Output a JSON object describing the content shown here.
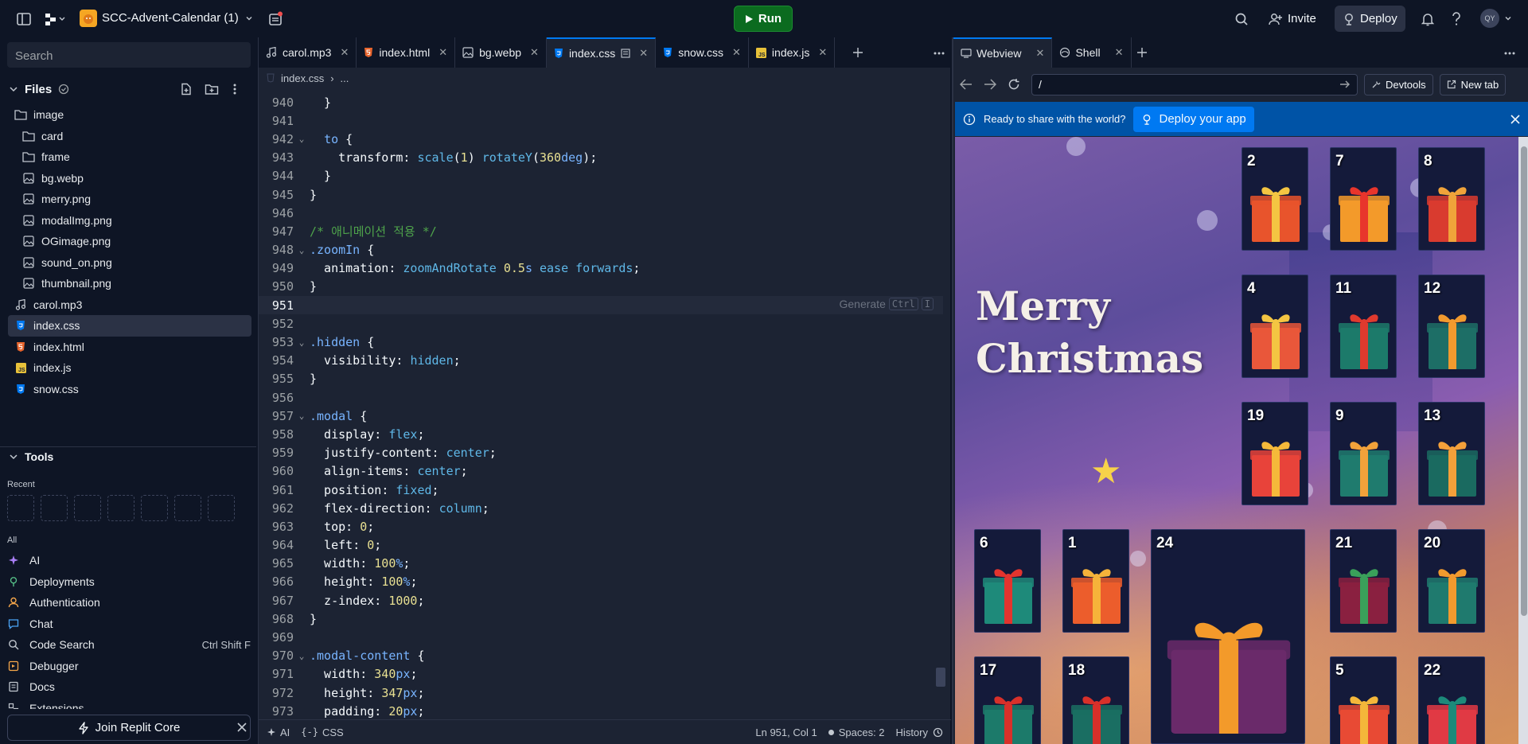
{
  "topbar": {
    "project_name": "SCC-Advent-Calendar (1)",
    "run_label": "Run",
    "invite_label": "Invite",
    "deploy_label": "Deploy",
    "avatar_initials": "QY"
  },
  "sidebar": {
    "search_placeholder": "Search",
    "files_label": "Files",
    "tree": [
      {
        "name": "image",
        "type": "folder",
        "depth": 0
      },
      {
        "name": "card",
        "type": "folder",
        "depth": 1
      },
      {
        "name": "frame",
        "type": "folder",
        "depth": 1
      },
      {
        "name": "bg.webp",
        "type": "image",
        "depth": 1
      },
      {
        "name": "merry.png",
        "type": "image",
        "depth": 1
      },
      {
        "name": "modalImg.png",
        "type": "image",
        "depth": 1
      },
      {
        "name": "OGimage.png",
        "type": "image",
        "depth": 1
      },
      {
        "name": "sound_on.png",
        "type": "image",
        "depth": 1
      },
      {
        "name": "thumbnail.png",
        "type": "image",
        "depth": 1
      },
      {
        "name": "carol.mp3",
        "type": "audio",
        "depth": 0
      },
      {
        "name": "index.css",
        "type": "css",
        "depth": 0,
        "selected": true
      },
      {
        "name": "index.html",
        "type": "html",
        "depth": 0
      },
      {
        "name": "index.js",
        "type": "js",
        "depth": 0
      },
      {
        "name": "snow.css",
        "type": "css",
        "depth": 0
      }
    ],
    "tools_label": "Tools",
    "recent_label": "Recent",
    "all_label": "All",
    "tools": [
      {
        "label": "AI",
        "icon": "ai-icon"
      },
      {
        "label": "Deployments",
        "icon": "deployments-icon"
      },
      {
        "label": "Authentication",
        "icon": "authentication-icon"
      },
      {
        "label": "Chat",
        "icon": "chat-icon"
      },
      {
        "label": "Code Search",
        "icon": "search-icon",
        "shortcut": "Ctrl Shift F"
      },
      {
        "label": "Debugger",
        "icon": "debugger-icon"
      },
      {
        "label": "Docs",
        "icon": "docs-icon"
      },
      {
        "label": "Extensions",
        "icon": "extensions-icon"
      }
    ],
    "join_label": "Join Replit Core"
  },
  "editor": {
    "tabs": [
      {
        "label": "carol.mp3",
        "icon": "audio-icon"
      },
      {
        "label": "index.html",
        "icon": "html-icon"
      },
      {
        "label": "bg.webp",
        "icon": "image-icon"
      },
      {
        "label": "index.css",
        "icon": "css-icon",
        "active": true
      },
      {
        "label": "snow.css",
        "icon": "css-icon"
      },
      {
        "label": "index.js",
        "icon": "js-icon"
      }
    ],
    "breadcrumb_file": "index.css",
    "breadcrumb_more": "...",
    "generate_hint": "Generate",
    "generate_key1": "Ctrl",
    "generate_key2": "I",
    "lines": [
      {
        "n": "940",
        "fold": false,
        "code": [
          [
            "  }",
            "#f5f9fc"
          ]
        ]
      },
      {
        "n": "941",
        "fold": false,
        "code": []
      },
      {
        "n": "942",
        "fold": true,
        "code": [
          [
            "  ",
            "#f5f9fc"
          ],
          [
            "to",
            "#78b4ff"
          ],
          [
            " {",
            "#f5f9fc"
          ]
        ]
      },
      {
        "n": "943",
        "fold": false,
        "code": [
          [
            "    ",
            "#f5f9fc"
          ],
          [
            "transform",
            "#f5f9fc"
          ],
          [
            ": ",
            "#f5f9fc"
          ],
          [
            "scale",
            "#5fb8e8"
          ],
          [
            "(",
            "#f5f9fc"
          ],
          [
            "1",
            "#e8e092"
          ],
          [
            ") ",
            "#f5f9fc"
          ],
          [
            "rotateY",
            "#5fb8e8"
          ],
          [
            "(",
            "#f5f9fc"
          ],
          [
            "360",
            "#e8e092"
          ],
          [
            "deg",
            "#78b4ff"
          ],
          [
            ");",
            "#f5f9fc"
          ]
        ]
      },
      {
        "n": "944",
        "fold": false,
        "code": [
          [
            "  }",
            "#f5f9fc"
          ]
        ]
      },
      {
        "n": "945",
        "fold": false,
        "code": [
          [
            "}",
            "#f5f9fc"
          ]
        ]
      },
      {
        "n": "946",
        "fold": false,
        "code": []
      },
      {
        "n": "947",
        "fold": false,
        "code": [
          [
            "/* 애니메이션 적용 */",
            "#4ea34b"
          ]
        ]
      },
      {
        "n": "948",
        "fold": true,
        "code": [
          [
            ".zoomIn",
            "#78b4ff"
          ],
          [
            " {",
            "#f5f9fc"
          ]
        ]
      },
      {
        "n": "949",
        "fold": false,
        "code": [
          [
            "  animation",
            "#f5f9fc"
          ],
          [
            ": ",
            "#f5f9fc"
          ],
          [
            "zoomAndRotate",
            "#5fb8e8"
          ],
          [
            " ",
            "#f5f9fc"
          ],
          [
            "0.5",
            "#e8e092"
          ],
          [
            "s",
            "#78b4ff"
          ],
          [
            " ",
            "#f5f9fc"
          ],
          [
            "ease forwards",
            "#5fb8e8"
          ],
          [
            ";",
            "#f5f9fc"
          ]
        ]
      },
      {
        "n": "950",
        "fold": false,
        "code": [
          [
            "}",
            "#f5f9fc"
          ]
        ]
      },
      {
        "n": "951",
        "fold": false,
        "current": true,
        "code": []
      },
      {
        "n": "952",
        "fold": false,
        "code": []
      },
      {
        "n": "953",
        "fold": true,
        "code": [
          [
            ".hidden",
            "#78b4ff"
          ],
          [
            " {",
            "#f5f9fc"
          ]
        ]
      },
      {
        "n": "954",
        "fold": false,
        "code": [
          [
            "  visibility",
            "#f5f9fc"
          ],
          [
            ": ",
            "#f5f9fc"
          ],
          [
            "hidden",
            "#5fb8e8"
          ],
          [
            ";",
            "#f5f9fc"
          ]
        ]
      },
      {
        "n": "955",
        "fold": false,
        "code": [
          [
            "}",
            "#f5f9fc"
          ]
        ]
      },
      {
        "n": "956",
        "fold": false,
        "code": []
      },
      {
        "n": "957",
        "fold": true,
        "code": [
          [
            ".modal",
            "#78b4ff"
          ],
          [
            " {",
            "#f5f9fc"
          ]
        ]
      },
      {
        "n": "958",
        "fold": false,
        "code": [
          [
            "  display",
            "#f5f9fc"
          ],
          [
            ": ",
            "#f5f9fc"
          ],
          [
            "flex",
            "#5fb8e8"
          ],
          [
            ";",
            "#f5f9fc"
          ]
        ]
      },
      {
        "n": "959",
        "fold": false,
        "code": [
          [
            "  justify-content",
            "#f5f9fc"
          ],
          [
            ": ",
            "#f5f9fc"
          ],
          [
            "center",
            "#5fb8e8"
          ],
          [
            ";",
            "#f5f9fc"
          ]
        ]
      },
      {
        "n": "960",
        "fold": false,
        "code": [
          [
            "  align-items",
            "#f5f9fc"
          ],
          [
            ": ",
            "#f5f9fc"
          ],
          [
            "center",
            "#5fb8e8"
          ],
          [
            ";",
            "#f5f9fc"
          ]
        ]
      },
      {
        "n": "961",
        "fold": false,
        "code": [
          [
            "  position",
            "#f5f9fc"
          ],
          [
            ": ",
            "#f5f9fc"
          ],
          [
            "fixed",
            "#5fb8e8"
          ],
          [
            ";",
            "#f5f9fc"
          ]
        ]
      },
      {
        "n": "962",
        "fold": false,
        "code": [
          [
            "  flex-direction",
            "#f5f9fc"
          ],
          [
            ": ",
            "#f5f9fc"
          ],
          [
            "column",
            "#5fb8e8"
          ],
          [
            ";",
            "#f5f9fc"
          ]
        ]
      },
      {
        "n": "963",
        "fold": false,
        "code": [
          [
            "  top",
            "#f5f9fc"
          ],
          [
            ": ",
            "#f5f9fc"
          ],
          [
            "0",
            "#e8e092"
          ],
          [
            ";",
            "#f5f9fc"
          ]
        ]
      },
      {
        "n": "964",
        "fold": false,
        "code": [
          [
            "  left",
            "#f5f9fc"
          ],
          [
            ": ",
            "#f5f9fc"
          ],
          [
            "0",
            "#e8e092"
          ],
          [
            ";",
            "#f5f9fc"
          ]
        ]
      },
      {
        "n": "965",
        "fold": false,
        "code": [
          [
            "  width",
            "#f5f9fc"
          ],
          [
            ": ",
            "#f5f9fc"
          ],
          [
            "100",
            "#e8e092"
          ],
          [
            "%",
            "#78b4ff"
          ],
          [
            ";",
            "#f5f9fc"
          ]
        ]
      },
      {
        "n": "966",
        "fold": false,
        "code": [
          [
            "  height",
            "#f5f9fc"
          ],
          [
            ": ",
            "#f5f9fc"
          ],
          [
            "100",
            "#e8e092"
          ],
          [
            "%",
            "#78b4ff"
          ],
          [
            ";",
            "#f5f9fc"
          ]
        ]
      },
      {
        "n": "967",
        "fold": false,
        "code": [
          [
            "  z-index",
            "#f5f9fc"
          ],
          [
            ": ",
            "#f5f9fc"
          ],
          [
            "1000",
            "#e8e092"
          ],
          [
            ";",
            "#f5f9fc"
          ]
        ]
      },
      {
        "n": "968",
        "fold": false,
        "code": [
          [
            "}",
            "#f5f9fc"
          ]
        ]
      },
      {
        "n": "969",
        "fold": false,
        "code": []
      },
      {
        "n": "970",
        "fold": true,
        "code": [
          [
            ".modal-content",
            "#78b4ff"
          ],
          [
            " {",
            "#f5f9fc"
          ]
        ]
      },
      {
        "n": "971",
        "fold": false,
        "code": [
          [
            "  width",
            "#f5f9fc"
          ],
          [
            ": ",
            "#f5f9fc"
          ],
          [
            "340",
            "#e8e092"
          ],
          [
            "px",
            "#78b4ff"
          ],
          [
            ";",
            "#f5f9fc"
          ]
        ]
      },
      {
        "n": "972",
        "fold": false,
        "code": [
          [
            "  height",
            "#f5f9fc"
          ],
          [
            ": ",
            "#f5f9fc"
          ],
          [
            "347",
            "#e8e092"
          ],
          [
            "px",
            "#78b4ff"
          ],
          [
            ";",
            "#f5f9fc"
          ]
        ]
      },
      {
        "n": "973",
        "fold": false,
        "code": [
          [
            "  padding",
            "#f5f9fc"
          ],
          [
            ": ",
            "#f5f9fc"
          ],
          [
            "20",
            "#e8e092"
          ],
          [
            "px",
            "#78b4ff"
          ],
          [
            ";",
            "#f5f9fc"
          ]
        ]
      }
    ],
    "status": {
      "ai": "AI",
      "lang": "CSS",
      "position": "Ln 951, Col 1",
      "spaces": "Spaces: 2",
      "history": "History"
    }
  },
  "preview": {
    "tabs": [
      {
        "label": "Webview",
        "icon": "monitor-icon",
        "active": true
      },
      {
        "label": "Shell",
        "icon": "shell-icon"
      }
    ],
    "url": "/",
    "devtools_label": "Devtools",
    "newtab_label": "New tab",
    "banner_text": "Ready to share with the world?",
    "banner_button": "Deploy your app",
    "app_title_line1": "Merry",
    "app_title_line2": "Christmas",
    "cards": [
      {
        "day": "2",
        "color": "#e8542c",
        "ribbon": "#f4c542"
      },
      {
        "day": "7",
        "color": "#f39a2a",
        "ribbon": "#e8352c"
      },
      {
        "day": "8",
        "color": "#d93b2f",
        "ribbon": "#f0a33a"
      },
      {
        "day": "4",
        "color": "#e9573a",
        "ribbon": "#f4c542"
      },
      {
        "day": "11",
        "color": "#1c7a6a",
        "ribbon": "#e03a2e"
      },
      {
        "day": "12",
        "color": "#1d6e66",
        "ribbon": "#f29a2e"
      },
      {
        "day": "19",
        "color": "#e8433a",
        "ribbon": "#f5b93a"
      },
      {
        "day": "9",
        "color": "#1f7b6e",
        "ribbon": "#f2a23a"
      },
      {
        "day": "13",
        "color": "#1a6a60",
        "ribbon": "#f3a03a"
      },
      {
        "day": "6",
        "color": "#1e8a7a",
        "ribbon": "#e3342e"
      },
      {
        "day": "1",
        "color": "#ec5d2c",
        "ribbon": "#f6b33a"
      },
      {
        "day": "24",
        "color": "#6a2a6a",
        "ribbon": "#f39a2a"
      },
      {
        "day": "21",
        "color": "#8a2040",
        "ribbon": "#3aa05a"
      },
      {
        "day": "20",
        "color": "#1f7a6e",
        "ribbon": "#f29a2e"
      },
      {
        "day": "17",
        "color": "#1c7a6a",
        "ribbon": "#d8302a"
      },
      {
        "day": "18",
        "color": "#1a6e62",
        "ribbon": "#d8302a"
      },
      {
        "day": "5",
        "color": "#e84a34",
        "ribbon": "#f4b73a"
      },
      {
        "day": "22",
        "color": "#e03a44",
        "ribbon": "#1c8a7a"
      }
    ]
  }
}
